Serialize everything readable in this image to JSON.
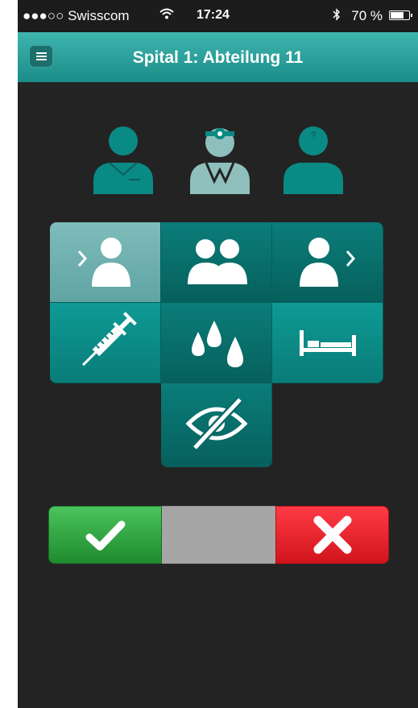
{
  "statusbar": {
    "carrier": "●●●○○ Swisscom",
    "time": "17:24",
    "battery": "70 %",
    "wifi_icon": "wifi-icon",
    "bluetooth_icon": "bluetooth-icon"
  },
  "navbar": {
    "title": "Spital 1: Abteilung 11",
    "menu_icon": "hamburger-menu-icon"
  },
  "roles": [
    {
      "name": "nurse",
      "icon": "nurse-icon",
      "color": "#0a8a85"
    },
    {
      "name": "doctor",
      "icon": "doctor-icon",
      "color": "#8fbfbd"
    },
    {
      "name": "unknown",
      "icon": "unknown-person-icon",
      "label": "?",
      "color": "#0a8a85"
    }
  ],
  "tiles": [
    {
      "icon": "person-arrow-in-icon",
      "selected": true
    },
    {
      "icon": "two-persons-icon"
    },
    {
      "icon": "person-arrow-out-icon"
    },
    {
      "icon": "syringe-icon"
    },
    {
      "icon": "drops-icon"
    },
    {
      "icon": "bed-icon"
    },
    {
      "icon": "eye-crossed-icon"
    }
  ],
  "confirm": {
    "ok_icon": "checkmark-icon",
    "cancel_icon": "cross-icon",
    "colors": {
      "ok": "#2aa43c",
      "neutral": "#a6a6a6",
      "cancel": "#e8222b"
    }
  }
}
